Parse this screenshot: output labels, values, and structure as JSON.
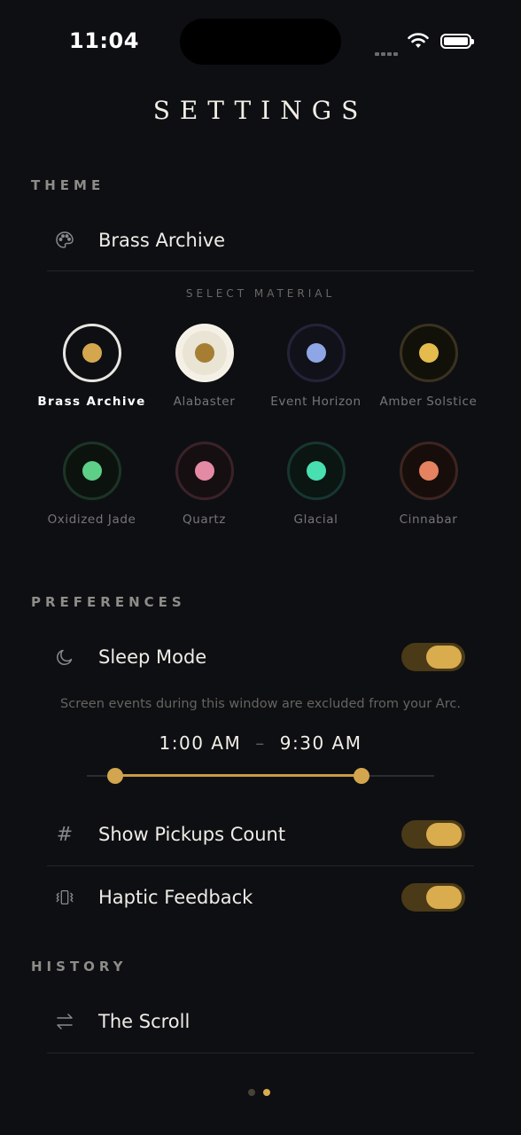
{
  "status": {
    "time": "11:04"
  },
  "page_title": "SETTINGS",
  "theme": {
    "section_label": "THEME",
    "current_theme": "Brass Archive",
    "select_label": "SELECT MATERIAL",
    "materials": [
      {
        "name": "Brass Archive",
        "dot": "#d4a74f",
        "ring": "#e8e6e1",
        "fill": "#0e0f13",
        "selected": true
      },
      {
        "name": "Alabaster",
        "dot": "#a57e34",
        "ring": "#f3efe4",
        "fill": "#eee9dc",
        "selected": false
      },
      {
        "name": "Event Horizon",
        "dot": "#8fa6e6",
        "ring": "#23243a",
        "fill": "#111219",
        "selected": false
      },
      {
        "name": "Amber Solstice",
        "dot": "#e5bb4d",
        "ring": "#3a3220",
        "fill": "#121109",
        "selected": false
      },
      {
        "name": "Oxidized Jade",
        "dot": "#5dcf86",
        "ring": "#1c3526",
        "fill": "#0c130f",
        "selected": false
      },
      {
        "name": "Quartz",
        "dot": "#e58aa4",
        "ring": "#3a2229",
        "fill": "#160f12",
        "selected": false
      },
      {
        "name": "Glacial",
        "dot": "#48dfb1",
        "ring": "#17362f",
        "fill": "#0b1512",
        "selected": false
      },
      {
        "name": "Cinnabar",
        "dot": "#e5825f",
        "ring": "#3d2520",
        "fill": "#170e0c",
        "selected": false
      }
    ]
  },
  "preferences": {
    "section_label": "PREFERENCES",
    "sleep_mode": {
      "label": "Sleep Mode",
      "enabled": true
    },
    "sleep_note": "Screen events during this window are excluded from your Arc.",
    "start_time": "1:00 AM",
    "separator": "–",
    "end_time": "9:30 AM",
    "show_pickups": {
      "label": "Show Pickups Count",
      "enabled": true
    },
    "haptic": {
      "label": "Haptic Feedback",
      "enabled": true
    }
  },
  "history": {
    "section_label": "HISTORY",
    "scroll_label": "The Scroll"
  },
  "pager": {
    "count": 2,
    "active": 1
  },
  "colors": {
    "accent": "#d9ac4e",
    "background": "#0e0f13",
    "toggle_track": "#4a3a17"
  }
}
